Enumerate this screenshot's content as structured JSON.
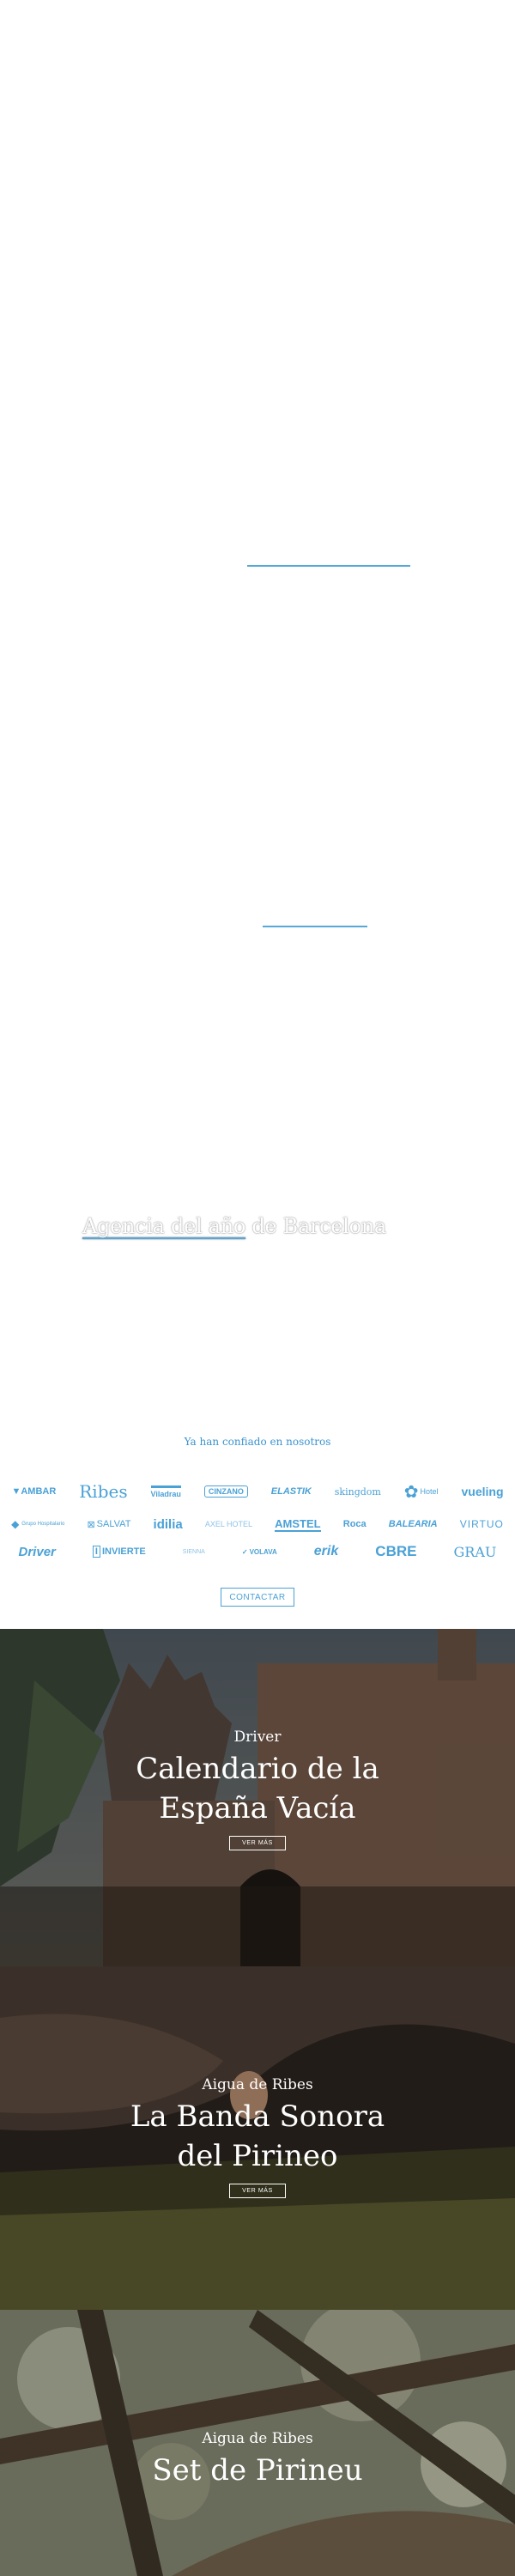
{
  "hero": {
    "agency_prefix": "Agencia del año",
    "agency_suffix": " de Barcelona"
  },
  "clients": {
    "heading": "Ya han confiado en nosotros",
    "rows": [
      [
        "AMBAR",
        "Ribes",
        "Viladrau",
        "CINZANO",
        "ELASTIK",
        "skingdom",
        "Hotel",
        "vueling"
      ],
      [
        "Grupo Hospitalario",
        "SALVAT",
        "idilia",
        "AXEL HOTEL",
        "AMSTEL",
        "Roca",
        "BALEARIA",
        "VIRTUO"
      ],
      [
        "Driver",
        "INVIERTE",
        "SIENNA",
        "VOLAVA",
        "erik",
        "CBRE",
        "GRAU"
      ]
    ],
    "contact_label": "CONTACTAR"
  },
  "cases": [
    {
      "client": "Driver",
      "title_line1": "Calendario de la",
      "title_line2": "España Vacía",
      "cta": "VER MÁS"
    },
    {
      "client": "Aigua de Ribes",
      "title_line1": "La Banda Sonora",
      "title_line2": "del Pirineo",
      "cta": "VER MÁS"
    },
    {
      "client": "Aigua de Ribes",
      "title_line1": "Set de Pirineu"
    }
  ],
  "colors": {
    "accent": "#4aa1d6"
  }
}
